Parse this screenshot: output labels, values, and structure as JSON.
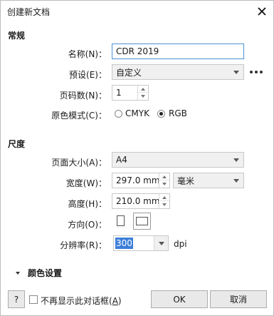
{
  "window": {
    "title": "创建新文档"
  },
  "general": {
    "heading": "常规",
    "name_label": "名称(N)：",
    "name_value": "CDR 2019",
    "preset_label": "预设(E)：",
    "preset_value": "自定义",
    "pages_label": "页码数(N)：",
    "pages_value": "1",
    "color_mode_label": "原色模式(C)：",
    "color_modes": [
      {
        "label": "CMYK",
        "selected": false
      },
      {
        "label": "RGB",
        "selected": true
      }
    ]
  },
  "dimensions": {
    "heading": "尺度",
    "page_size_label": "页面大小(A)：",
    "page_size_value": "A4",
    "width_label": "宽度(W)：",
    "width_value": "297.0 mm",
    "unit_value": "毫米",
    "height_label": "高度(H)：",
    "height_value": "210.0 mm",
    "orientation_label": "方向(O)：",
    "orientation_selected": "landscape",
    "resolution_label": "分辨率(R)：",
    "resolution_value": "300",
    "resolution_unit": "dpi"
  },
  "color_settings": {
    "label": "颜色设置",
    "expanded": false
  },
  "footer": {
    "help_label": "?",
    "dont_show_prefix": "不再显示此对话框(",
    "dont_show_key": "A",
    "dont_show_suffix": ")",
    "dont_show_checked": false,
    "ok_label": "OK",
    "cancel_label": "取消"
  },
  "icons": {
    "close": "close-icon",
    "more": "more-options-icon",
    "expander": "triangle-right-icon"
  }
}
